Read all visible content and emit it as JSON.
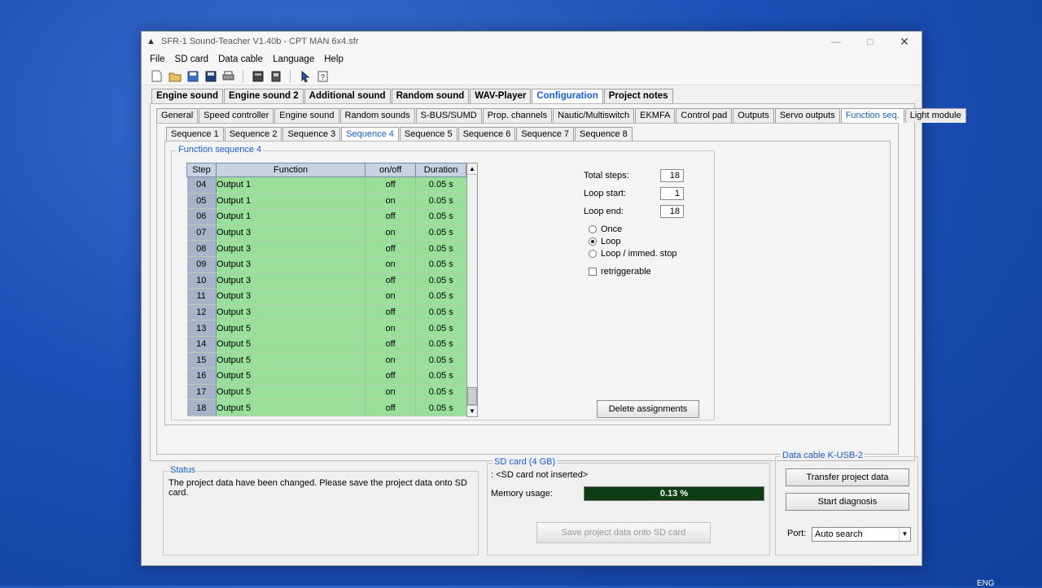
{
  "window": {
    "title": "SFR-1 Sound-Teacher V1.40b - CPT MAN 6x4.sfr"
  },
  "menu": [
    "File",
    "SD card",
    "Data cable",
    "Language",
    "Help"
  ],
  "main_tabs": [
    "Engine sound",
    "Engine sound 2",
    "Additional sound",
    "Random sound",
    "WAV-Player",
    "Configuration",
    "Project notes"
  ],
  "main_tab_active": "Configuration",
  "config_tabs": [
    "General",
    "Speed controller",
    "Engine sound",
    "Random sounds",
    "S-BUS/SUMD",
    "Prop. channels",
    "Nautic/Multiswitch",
    "EKMFA",
    "Control pad",
    "Outputs",
    "Servo outputs",
    "Function seq.",
    "Light module"
  ],
  "config_tab_active": "Function seq.",
  "seq_tabs": [
    "Sequence 1",
    "Sequence 2",
    "Sequence 3",
    "Sequence 4",
    "Sequence 5",
    "Sequence 6",
    "Sequence 7",
    "Sequence 8"
  ],
  "seq_tab_active": "Sequence 4",
  "function_group_title": "Function sequence 4",
  "table": {
    "headers": {
      "step": "Step",
      "function": "Function",
      "onoff": "on/off",
      "duration": "Duration"
    },
    "rows": [
      {
        "step": "04",
        "function": "Output 1",
        "onoff": "off",
        "duration": "0.05 s"
      },
      {
        "step": "05",
        "function": "Output 1",
        "onoff": "on",
        "duration": "0.05 s"
      },
      {
        "step": "06",
        "function": "Output 1",
        "onoff": "off",
        "duration": "0.05 s"
      },
      {
        "step": "07",
        "function": "Output 3",
        "onoff": "on",
        "duration": "0.05 s"
      },
      {
        "step": "08",
        "function": "Output 3",
        "onoff": "off",
        "duration": "0.05 s"
      },
      {
        "step": "09",
        "function": "Output 3",
        "onoff": "on",
        "duration": "0.05 s"
      },
      {
        "step": "10",
        "function": "Output 3",
        "onoff": "off",
        "duration": "0.05 s"
      },
      {
        "step": "11",
        "function": "Output 3",
        "onoff": "on",
        "duration": "0.05 s"
      },
      {
        "step": "12",
        "function": "Output 3",
        "onoff": "off",
        "duration": "0.05 s"
      },
      {
        "step": "13",
        "function": "Output 5",
        "onoff": "on",
        "duration": "0.05 s"
      },
      {
        "step": "14",
        "function": "Output 5",
        "onoff": "off",
        "duration": "0.05 s"
      },
      {
        "step": "15",
        "function": "Output 5",
        "onoff": "on",
        "duration": "0.05 s"
      },
      {
        "step": "16",
        "function": "Output 5",
        "onoff": "off",
        "duration": "0.05 s"
      },
      {
        "step": "17",
        "function": "Output 5",
        "onoff": "on",
        "duration": "0.05 s"
      },
      {
        "step": "18",
        "function": "Output 5",
        "onoff": "off",
        "duration": "0.05 s"
      }
    ]
  },
  "settings": {
    "total_steps_label": "Total steps:",
    "total_steps": "18",
    "loop_start_label": "Loop start:",
    "loop_start": "1",
    "loop_end_label": "Loop end:",
    "loop_end": "18",
    "radio_once": "Once",
    "radio_loop": "Loop",
    "radio_loop_stop": "Loop / immed. stop",
    "selected_radio": "Loop",
    "retriggerable_label": "retriggerable",
    "retriggerable": false,
    "delete_button": "Delete assignments"
  },
  "status": {
    "title": "Status",
    "message": "The project data have been changed. Please save the project data onto SD card."
  },
  "sdcard": {
    "title": "SD card (4 GB)",
    "state": ": <SD card not inserted>",
    "memory_label": "Memory usage:",
    "memory_value": "0.13 %",
    "memory_fraction": 0.0013,
    "save_button": "Save project data onto SD card"
  },
  "datacable": {
    "title": "Data cable K-USB-2",
    "transfer_button": "Transfer project data",
    "diagnosis_button": "Start diagnosis",
    "port_label": "Port:",
    "port_value": "Auto search"
  },
  "taskbar_lang": "ENG",
  "colors": {
    "active_tab": "#1a5bd0",
    "table_green": "#99df9a",
    "progress": "#0e3d14"
  }
}
